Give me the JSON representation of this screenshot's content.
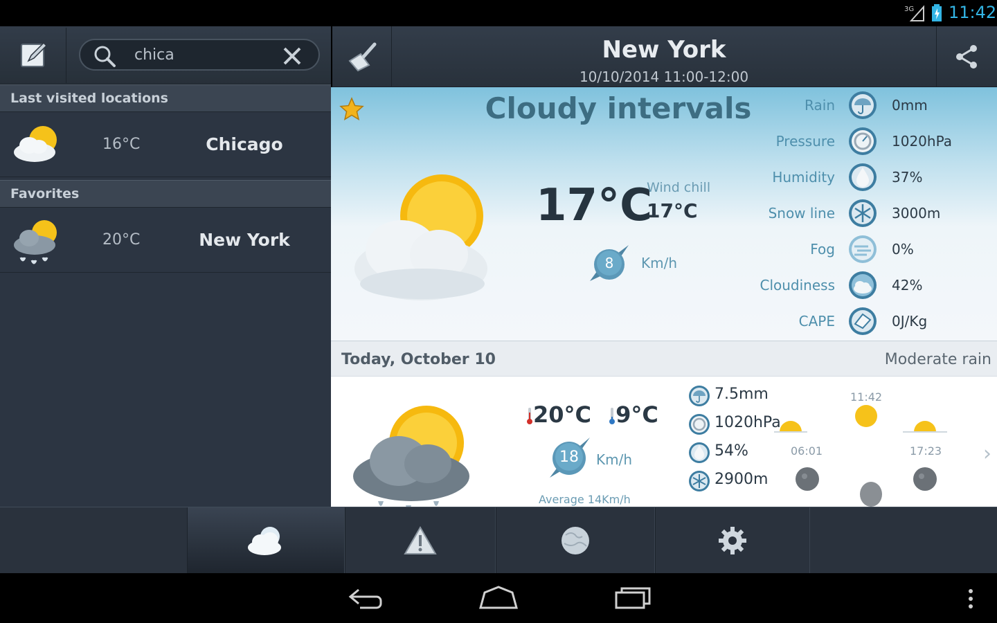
{
  "status_bar": {
    "network": "3G",
    "time": "11:42"
  },
  "search": {
    "value": "chica",
    "search_icon": "search-icon",
    "clear_icon": "close-icon"
  },
  "sidebar": {
    "last_visited_header": "Last visited locations",
    "favorites_header": "Favorites",
    "last_visited": [
      {
        "temp": "16°C",
        "name": "Chicago",
        "icon": "partly-cloudy-icon"
      }
    ],
    "favorites": [
      {
        "temp": "20°C",
        "name": "New York",
        "icon": "rain-sun-icon"
      }
    ]
  },
  "header": {
    "title": "New York",
    "subtitle": "10/10/2014  11:00-12:00",
    "share_icon": "share-icon",
    "clear_icon": "broom-icon"
  },
  "current": {
    "condition": "Cloudy intervals",
    "temp": "17°C",
    "wind_chill_label": "Wind chill",
    "wind_chill_value": "17°C",
    "wind_speed": "8",
    "wind_unit": "Km/h",
    "details": [
      {
        "label": "Rain",
        "value": "0mm",
        "icon": "umbrella-icon"
      },
      {
        "label": "Pressure",
        "value": "1020hPa",
        "icon": "gauge-icon"
      },
      {
        "label": "Humidity",
        "value": "37%",
        "icon": "drop-icon"
      },
      {
        "label": "Snow line",
        "value": "3000m",
        "icon": "snowflake-icon"
      },
      {
        "label": "Fog",
        "value": "0%",
        "icon": "fog-icon"
      },
      {
        "label": "Cloudiness",
        "value": "42%",
        "icon": "cloud-icon"
      },
      {
        "label": "CAPE",
        "value": "0J/Kg",
        "icon": "cape-icon"
      }
    ]
  },
  "today": {
    "label": "Today, October 10",
    "summary": "Moderate rain"
  },
  "forecast": {
    "max": "20°C",
    "min": "9°C",
    "wind_speed": "18",
    "wind_unit": "Km/h",
    "average": "Average 14Km/h",
    "rows": [
      {
        "value": "7.5mm",
        "icon": "umbrella-icon"
      },
      {
        "value": "1020hPa",
        "icon": "gauge-icon"
      },
      {
        "value": "54%",
        "icon": "drop-icon"
      },
      {
        "value": "2900m",
        "icon": "snowflake-icon"
      }
    ],
    "sunrise": "06:01",
    "now": "11:42",
    "sunset": "17:23"
  },
  "tabs": [
    {
      "icon": "weather-icon",
      "active": true
    },
    {
      "icon": "warning-icon",
      "active": false
    },
    {
      "icon": "globe-icon",
      "active": false
    },
    {
      "icon": "settings-icon",
      "active": false
    }
  ],
  "colors": {
    "accent": "#33b5e5",
    "panel": "#2c3542",
    "title_blue": "#3d6d82"
  }
}
